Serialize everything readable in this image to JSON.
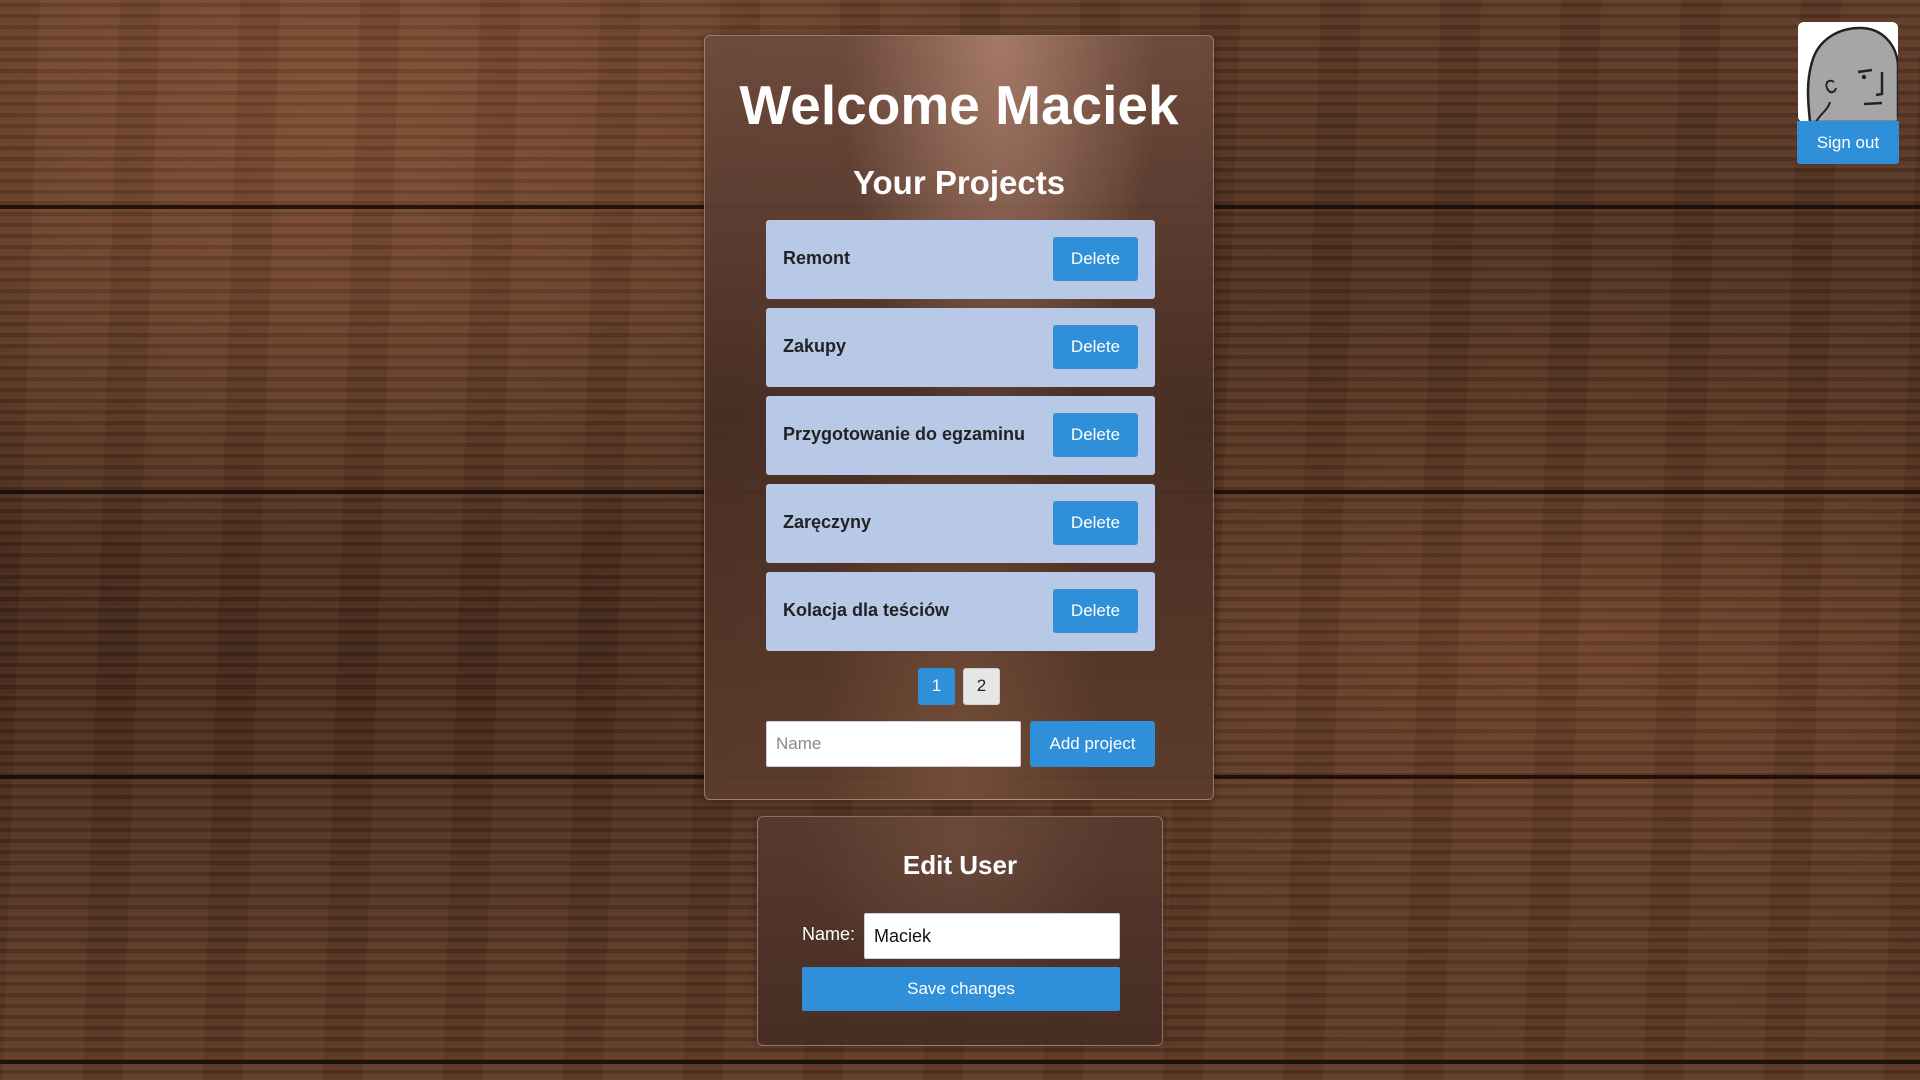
{
  "header": {
    "welcome": "Welcome Maciek"
  },
  "projects": {
    "heading": "Your Projects",
    "items": [
      {
        "name": "Remont",
        "delete_label": "Delete"
      },
      {
        "name": "Zakupy",
        "delete_label": "Delete"
      },
      {
        "name": "Przygotowanie do egzaminu",
        "delete_label": "Delete"
      },
      {
        "name": "Zaręczyny",
        "delete_label": "Delete"
      },
      {
        "name": "Kolacja dla teściów",
        "delete_label": "Delete"
      }
    ],
    "pages": [
      "1",
      "2"
    ],
    "active_page": "1",
    "new_project": {
      "placeholder": "Name",
      "value": "",
      "add_label": "Add project"
    }
  },
  "edit_user": {
    "heading": "Edit User",
    "name_label": "Name:",
    "name_value": "Maciek",
    "save_label": "Save changes"
  },
  "account": {
    "avatar_icon": "user-avatar-icon",
    "signout_label": "Sign out"
  },
  "colors": {
    "accent": "#2f8fd8",
    "project_card": "#b7c9e7",
    "page_inactive": "#e6e6e6"
  }
}
